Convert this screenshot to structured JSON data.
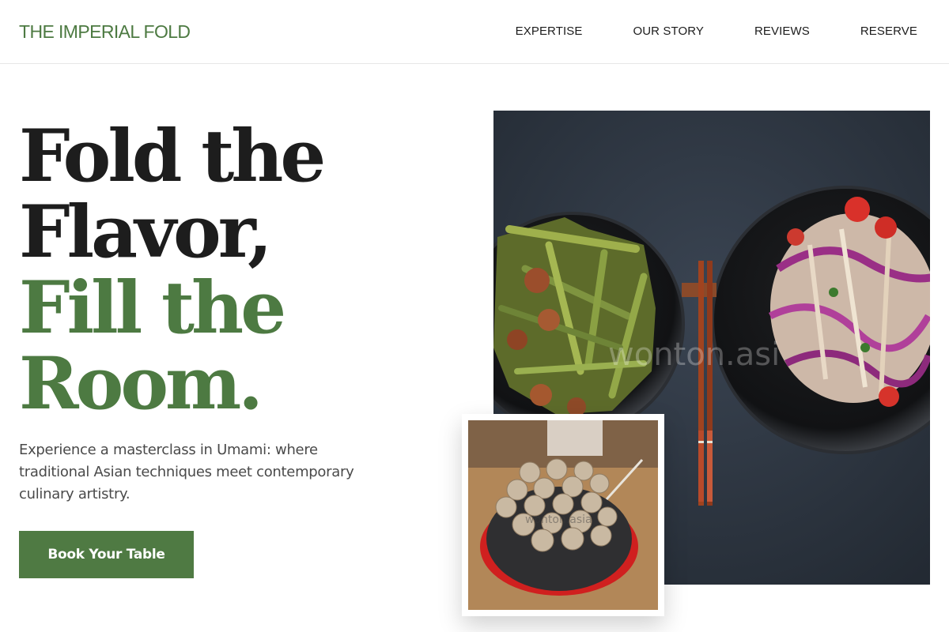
{
  "brand": "THE IMPERIAL FOLD",
  "nav": {
    "items": [
      {
        "label": "EXPERTISE"
      },
      {
        "label": "OUR STORY"
      },
      {
        "label": "REVIEWS"
      },
      {
        "label": "RESERVE"
      }
    ]
  },
  "hero": {
    "line1": "Fold the",
    "line2": "Flavor,",
    "line3": "Fill the",
    "line4": "Room.",
    "subtitle": "Experience a masterclass in Umami: where traditional Asian techniques meet contemporary culinary artistry.",
    "cta_label": "Book Your Table"
  },
  "images": {
    "main_watermark": "wonton.asi",
    "inset_watermark": "wonton.asia"
  },
  "colors": {
    "accent": "#4f7a43",
    "text_dark": "#1d1d1d",
    "text_muted": "#4a4a4a",
    "photo_background": "#2c3440"
  }
}
